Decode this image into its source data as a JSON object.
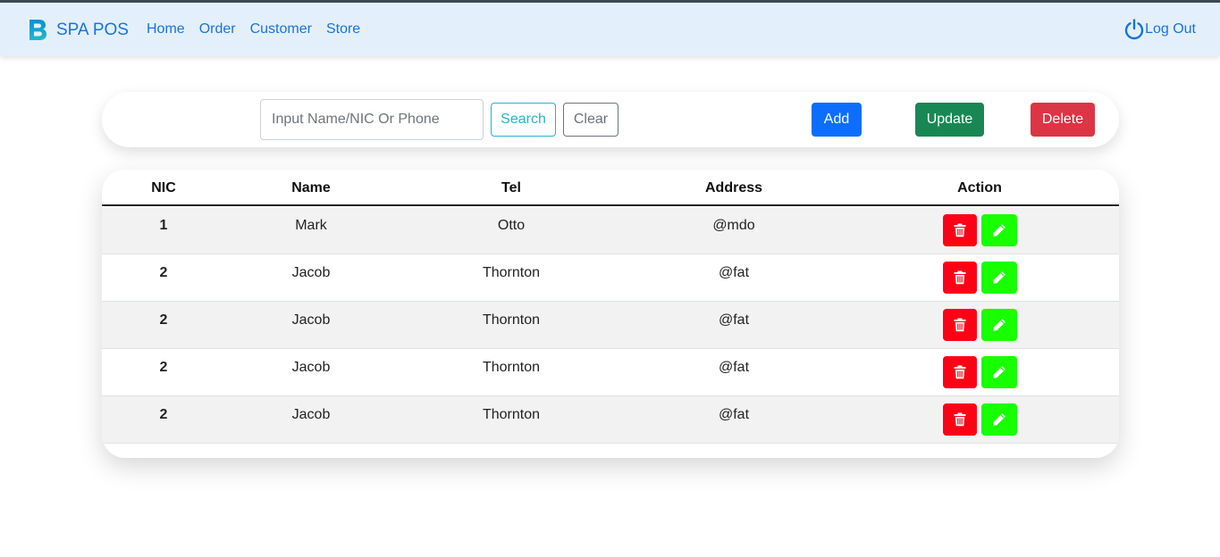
{
  "navbar": {
    "brand": "SPA POS",
    "links": [
      "Home",
      "Order",
      "Customer",
      "Store"
    ],
    "logout": "Log Out"
  },
  "toolbar": {
    "search_placeholder": "Input Name/NIC Or Phone",
    "search_value": "",
    "search_label": "Search",
    "clear_label": "Clear",
    "add_label": "Add",
    "update_label": "Update",
    "delete_label": "Delete"
  },
  "table": {
    "headers": [
      "NIC",
      "Name",
      "Tel",
      "Address",
      "Action"
    ],
    "rows": [
      {
        "nic": "1",
        "name": "Mark",
        "tel": "Otto",
        "address": "@mdo"
      },
      {
        "nic": "2",
        "name": "Jacob",
        "tel": "Thornton",
        "address": "@fat"
      },
      {
        "nic": "2",
        "name": "Jacob",
        "tel": "Thornton",
        "address": "@fat"
      },
      {
        "nic": "2",
        "name": "Jacob",
        "tel": "Thornton",
        "address": "@fat"
      },
      {
        "nic": "2",
        "name": "Jacob",
        "tel": "Thornton",
        "address": "@fat"
      }
    ],
    "row_actions": {
      "delete_icon": "trash-icon",
      "edit_icon": "pencil-icon"
    }
  },
  "colors": {
    "nav_bg": "#e3f0fb",
    "link": "#1a73d9",
    "primary": "#0d6efd",
    "success": "#198754",
    "danger": "#dc3545",
    "info": "#24b5cf",
    "row_delete": "#ff0015",
    "row_edit": "#18ff00"
  }
}
